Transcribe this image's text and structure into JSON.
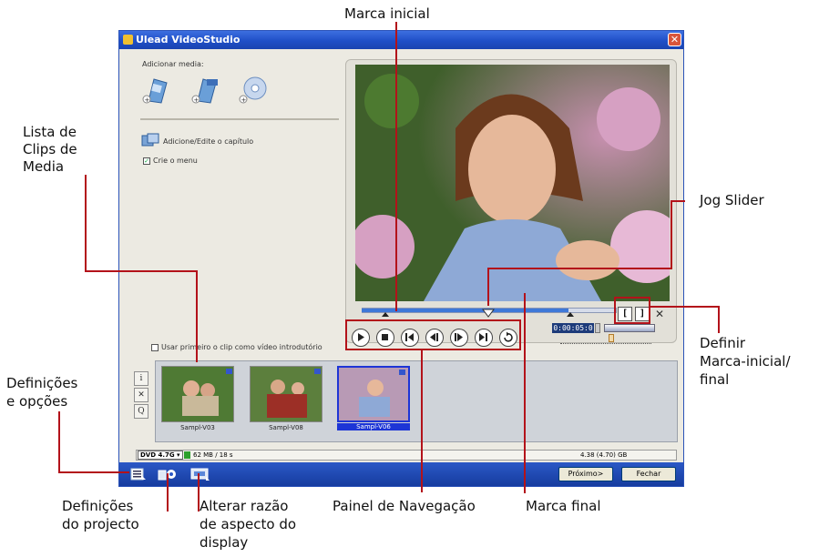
{
  "window": {
    "title": "Ulead VideoStudio",
    "close_glyph": "✕"
  },
  "left_panel": {
    "add_media_label": "Adicionar media:",
    "add_chapter_label": "Adicione/Edite o capítulo",
    "create_menu_label": "Crie o menu",
    "create_menu_checked": true,
    "intro_clip_label": "Usar primeiro o clip como vídeo introdutório",
    "intro_clip_checked": false
  },
  "player": {
    "timecode": "0:00:05:0",
    "buttons": [
      "play-icon",
      "stop-icon",
      "go-start-icon",
      "prev-frame-icon",
      "next-frame-icon",
      "go-end-icon",
      "repeat-icon"
    ],
    "mark_in_glyph": "[",
    "mark_out_glyph": "]",
    "clear_glyph": "✕"
  },
  "clips": [
    {
      "label": "Sampl-V03",
      "selected": false
    },
    {
      "label": "Sampl-V08",
      "selected": false
    },
    {
      "label": "Sampl-V06",
      "selected": true
    }
  ],
  "side_tools": [
    "i",
    "✕",
    "Q"
  ],
  "status": {
    "disc_type": "DVD 4.7G",
    "used": "62 MB / 18 s",
    "capacity": "4.38 (4.70) GB"
  },
  "bottom": {
    "next_label": "Próximo>",
    "close_label": "Fechar"
  },
  "callouts": {
    "marca_inicial": "Marca inicial",
    "lista_clips": [
      "Lista de",
      "Clips de",
      "Media"
    ],
    "jog_slider": "Jog Slider",
    "definir_marca": [
      "Definir",
      "Marca-inicial/",
      "final"
    ],
    "definicoes_opcoes": [
      "Definições",
      "e opções"
    ],
    "definicoes_projecto": [
      "Definições",
      "do projecto"
    ],
    "alterar_razao": [
      "Alterar razão",
      "de aspecto do",
      "display"
    ],
    "painel_navegacao": "Painel de Navegação",
    "marca_final": "Marca final"
  },
  "colors": {
    "leader_line": "#b3121a",
    "titlebar": "#1f4fc7",
    "window_bg": "#eceae2",
    "selection": "#1d35d6"
  }
}
